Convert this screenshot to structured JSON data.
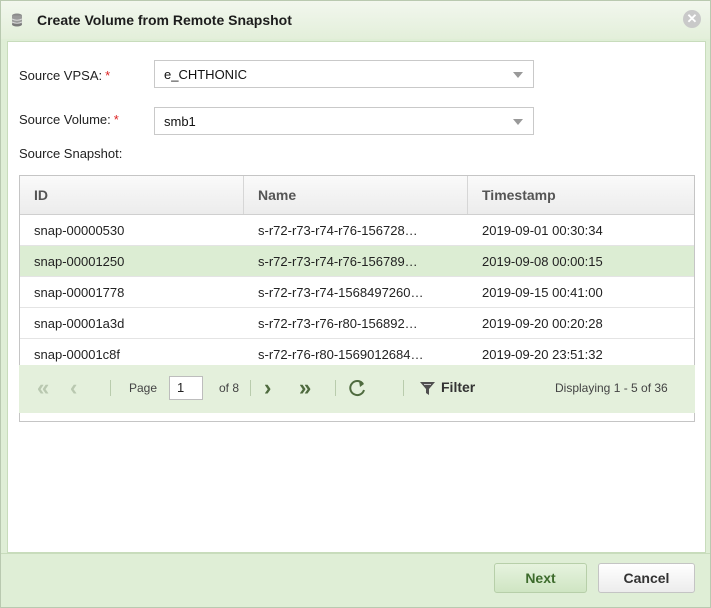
{
  "dialog": {
    "title": "Create Volume from Remote Snapshot",
    "close_symbol": "✕"
  },
  "form": {
    "source_vpsa_label": "Source VPSA:",
    "source_vpsa_value": "e_CHTHONIC",
    "source_volume_label": "Source Volume:",
    "source_volume_value": "smb1",
    "source_snapshot_label": "Source Snapshot:",
    "required_mark": "*"
  },
  "grid": {
    "columns": [
      "ID",
      "Name",
      "Timestamp"
    ],
    "rows": [
      {
        "id": "snap-00000530",
        "name": "s-r72-r73-r74-r76-156728…",
        "timestamp": "2019-09-01 00:30:34"
      },
      {
        "id": "snap-00001250",
        "name": "s-r72-r73-r74-r76-156789…",
        "timestamp": "2019-09-08 00:00:15"
      },
      {
        "id": "snap-00001778",
        "name": "s-r72-r73-r74-1568497260…",
        "timestamp": "2019-09-15 00:41:00"
      },
      {
        "id": "snap-00001a3d",
        "name": "s-r72-r73-r76-r80-156892…",
        "timestamp": "2019-09-20 00:20:28"
      },
      {
        "id": "snap-00001c8f",
        "name": "s-r72-r76-r80-1569012684…",
        "timestamp": "2019-09-20 23:51:32"
      }
    ],
    "selected_row": 1
  },
  "pager": {
    "page_label": "Page",
    "page_value": "1",
    "of_label": "of 8",
    "filter_label": "Filter",
    "displaying": "Displaying 1 - 5 of 36"
  },
  "buttons": {
    "next": "Next",
    "cancel": "Cancel"
  }
}
